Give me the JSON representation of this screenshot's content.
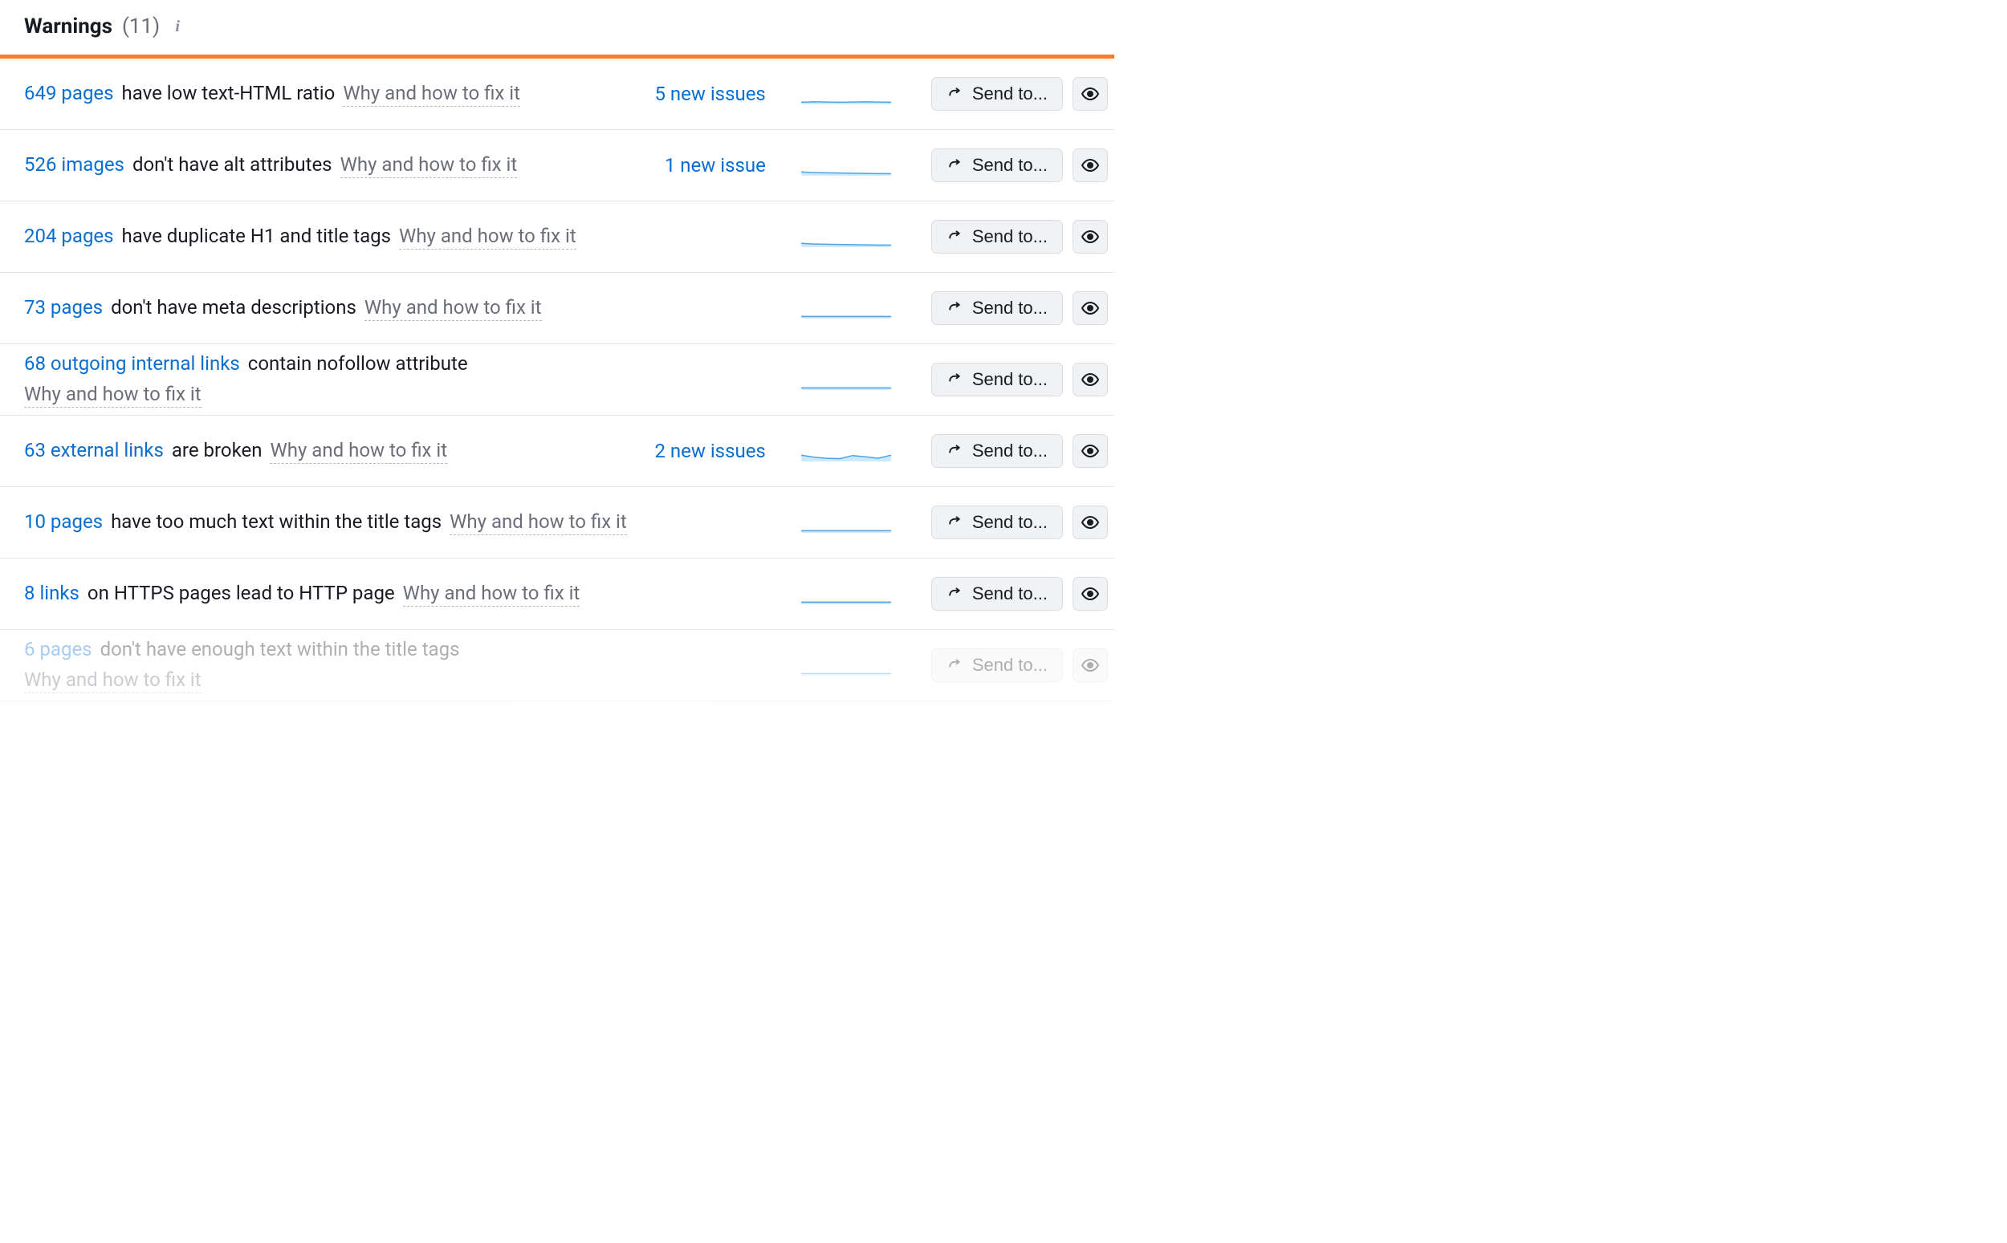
{
  "header": {
    "title": "Warnings",
    "count_display": "(11)"
  },
  "labels": {
    "why_and_how": "Why and how to fix it",
    "send_to": "Send to..."
  },
  "colors": {
    "accent_orange": "#ff7a2e",
    "link_blue": "#0a6ed1",
    "spark_fill": "#cde9fb",
    "spark_stroke": "#4fa3e3"
  },
  "rows": [
    {
      "count_link": "649 pages",
      "text": "have low text-HTML ratio",
      "new_issues": "5 new issues",
      "spark": [
        0.1,
        0.12,
        0.11,
        0.1,
        0.11,
        0.12,
        0.11,
        0.1
      ]
    },
    {
      "count_link": "526 images",
      "text": "don't have alt attributes",
      "new_issues": "1 new issue",
      "spark": [
        0.18,
        0.15,
        0.14,
        0.13,
        0.12,
        0.11,
        0.1,
        0.1
      ]
    },
    {
      "count_link": "204 pages",
      "text": "have duplicate H1 and title tags",
      "new_issues": "",
      "spark": [
        0.18,
        0.15,
        0.14,
        0.13,
        0.12,
        0.11,
        0.1,
        0.1
      ]
    },
    {
      "count_link": "73 pages",
      "text": "don't have meta descriptions",
      "new_issues": "",
      "spark": [
        0.1,
        0.1,
        0.1,
        0.1,
        0.1,
        0.1,
        0.1,
        0.1
      ]
    },
    {
      "count_link": "68 outgoing internal links",
      "text": "contain nofollow attribute",
      "new_issues": "",
      "spark": [
        0.1,
        0.1,
        0.1,
        0.1,
        0.1,
        0.1,
        0.1,
        0.1
      ]
    },
    {
      "count_link": "63 external links",
      "text": "are broken",
      "new_issues": "2 new issues",
      "spark": [
        0.3,
        0.2,
        0.15,
        0.13,
        0.28,
        0.22,
        0.15,
        0.3
      ]
    },
    {
      "count_link": "10 pages",
      "text": "have too much text within the title tags",
      "new_issues": "",
      "spark": [
        0.1,
        0.1,
        0.1,
        0.1,
        0.1,
        0.1,
        0.1,
        0.1
      ]
    },
    {
      "count_link": "8 links",
      "text": "on HTTPS pages lead to HTTP page",
      "new_issues": "",
      "spark": [
        0.1,
        0.1,
        0.1,
        0.1,
        0.1,
        0.1,
        0.1,
        0.1
      ]
    },
    {
      "count_link": "6 pages",
      "text": "don't have enough text within the title tags",
      "new_issues": "",
      "spark": [
        0.1,
        0.1,
        0.1,
        0.1,
        0.1,
        0.1,
        0.1,
        0.1
      ],
      "faded": true
    }
  ]
}
